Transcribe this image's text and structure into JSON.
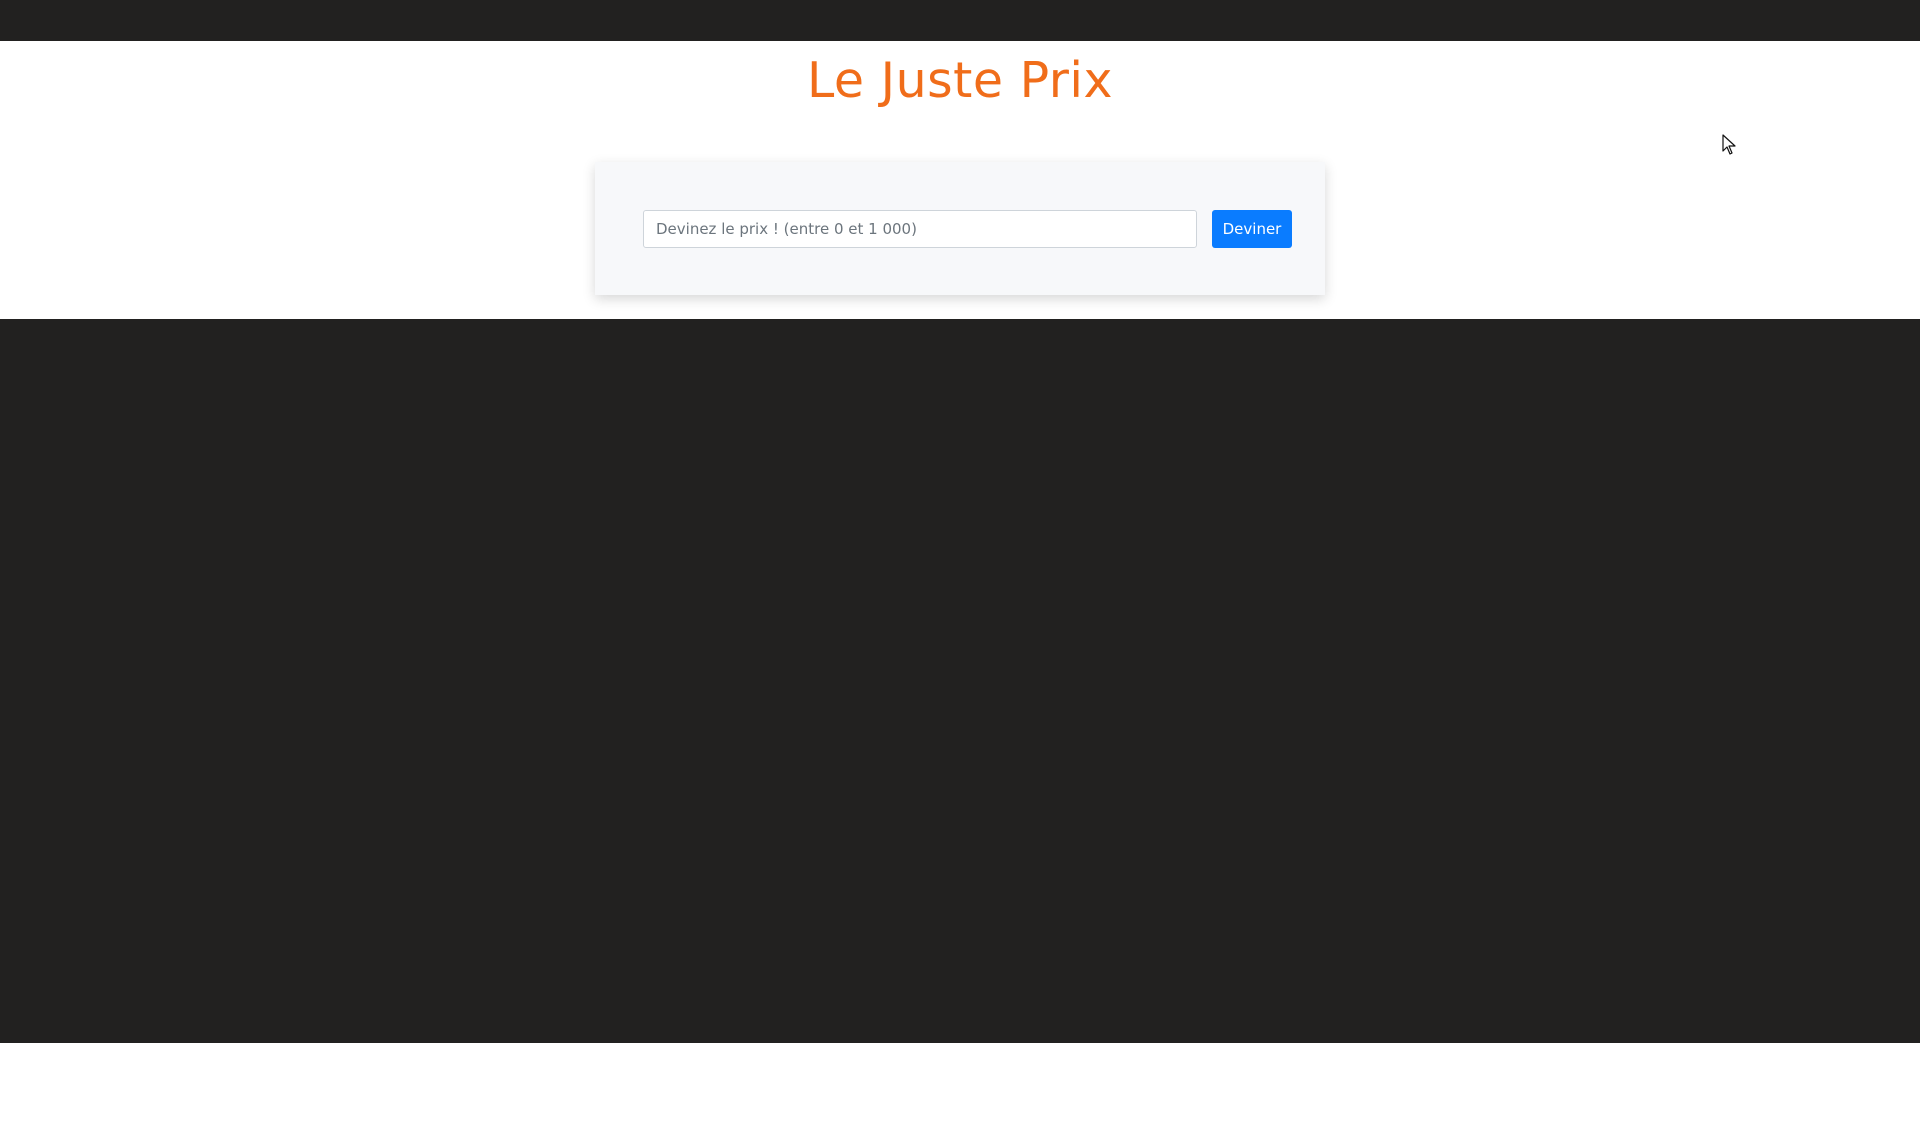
{
  "header": {
    "title": "Le Juste Prix"
  },
  "form": {
    "input": {
      "placeholder": "Devinez le prix ! (entre 0 et 1 000)",
      "value": ""
    },
    "submit_label": "Deviner"
  },
  "colors": {
    "title": "#f06d1a",
    "button": "#0a7cff",
    "dark_band": "#222120",
    "card_background": "#f7f8fa"
  },
  "icons": {
    "cursor": "mouse-pointer-icon"
  }
}
